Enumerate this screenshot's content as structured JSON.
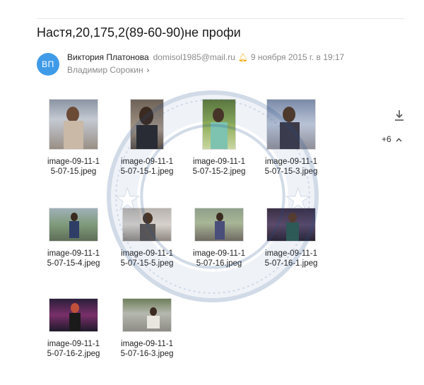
{
  "email": {
    "subject": "Настя,20,175,2(89-60-90)не профи",
    "avatar_initials": "ВП",
    "sender_name": "Виктория Платонова",
    "sender_email": "domisol1985@mail.ru",
    "sent_date": "9 ноября 2015 г. в 19:17",
    "recipient": "Владимир Сорокин"
  },
  "attachments": {
    "more_label": "+6",
    "items": [
      {
        "file": "image-09-11-15-07-15.jpeg",
        "line1": "image-09-11-1",
        "line2": "5-07-15.jpeg"
      },
      {
        "file": "image-09-11-15-07-15-1.jpeg",
        "line1": "image-09-11-1",
        "line2": "5-07-15-1.jpeg"
      },
      {
        "file": "image-09-11-15-07-15-2.jpeg",
        "line1": "image-09-11-1",
        "line2": "5-07-15-2.jpeg"
      },
      {
        "file": "image-09-11-15-07-15-3.jpeg",
        "line1": "image-09-11-1",
        "line2": "5-07-15-3.jpeg"
      },
      {
        "file": "image-09-11-15-07-15-4.jpeg",
        "line1": "image-09-11-1",
        "line2": "5-07-15-4.jpeg"
      },
      {
        "file": "image-09-11-15-07-15-5.jpeg",
        "line1": "image-09-11-1",
        "line2": "5-07-15-5.jpeg"
      },
      {
        "file": "image-09-11-15-07-16.jpeg",
        "line1": "image-09-11-1",
        "line2": "5-07-16.jpeg"
      },
      {
        "file": "image-09-11-15-07-16-1.jpeg",
        "line1": "image-09-11-1",
        "line2": "5-07-16-1.jpeg"
      },
      {
        "file": "image-09-11-15-07-16-2.jpeg",
        "line1": "image-09-11-1",
        "line2": "5-07-16-2.jpeg"
      },
      {
        "file": "image-09-11-15-07-16-3.jpeg",
        "line1": "image-09-11-1",
        "line2": "5-07-16-3.jpeg"
      }
    ]
  },
  "colors": {
    "avatar": "#3f9be8",
    "muted_text": "#8a8a8a",
    "watermark": "#1f4e8c"
  },
  "icons": [
    "download-icon",
    "chevron-up-icon",
    "chevron-right-icon",
    "bell-icon"
  ]
}
